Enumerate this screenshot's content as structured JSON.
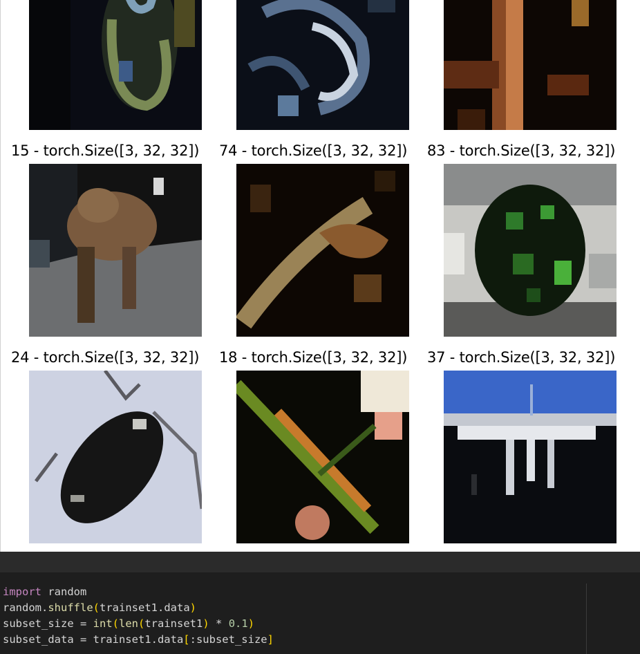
{
  "figure": {
    "captions": [
      "15 - torch.Size([3, 32, 32])",
      "74 - torch.Size([3, 32, 32])",
      "83 - torch.Size([3, 32, 32])",
      "24 - torch.Size([3, 32, 32])",
      "18 - torch.Size([3, 32, 32])",
      "37 - torch.Size([3, 32, 32])"
    ],
    "images": [
      "image-1",
      "image-2",
      "image-3",
      "image-4-deer",
      "image-5",
      "image-6-frog",
      "image-7-cockroach",
      "image-8",
      "image-9-bridge"
    ]
  },
  "code": {
    "lines": [
      {
        "parts": [
          [
            "kw",
            "import"
          ],
          [
            "",
            " random"
          ]
        ]
      },
      {
        "parts": [
          [
            "",
            "random."
          ],
          [
            "fn",
            "shuffle"
          ],
          [
            "br",
            "("
          ],
          [
            "",
            "trainset1.data"
          ],
          [
            "br",
            ")"
          ]
        ]
      },
      {
        "parts": [
          [
            "",
            "subset_size = "
          ],
          [
            "fn",
            "int"
          ],
          [
            "br",
            "("
          ],
          [
            "fn",
            "len"
          ],
          [
            "br",
            "("
          ],
          [
            "",
            "trainset1"
          ],
          [
            "br",
            ")"
          ],
          [
            "",
            " * "
          ],
          [
            "num",
            "0.1"
          ],
          [
            "br",
            ")"
          ]
        ]
      },
      {
        "parts": [
          [
            "",
            "subset_data = trainset1.data"
          ],
          [
            "br",
            "["
          ],
          [
            "",
            ":subset_size"
          ],
          [
            "br",
            "]"
          ]
        ]
      }
    ]
  }
}
